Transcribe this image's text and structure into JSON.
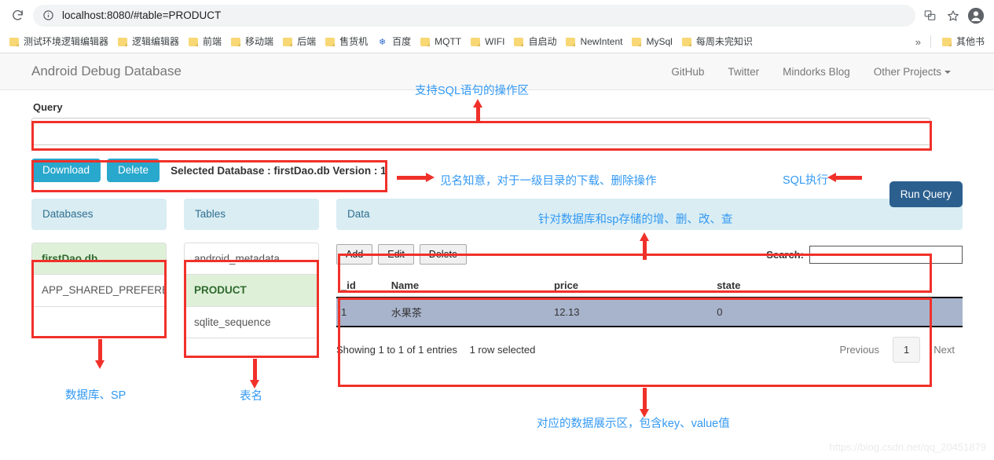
{
  "browser": {
    "url": "localhost:8080/#table=PRODUCT",
    "reload_icon": "reload-icon",
    "info_icon": "info-circle-icon",
    "translate_icon": "translate-icon",
    "bookmark_star_icon": "star-icon",
    "profile_icon": "account-avatar-icon",
    "overflow_icon": "chevron-double-right-icon",
    "bookmarks": [
      {
        "label": "测试环境逻辑编辑器",
        "icon": "folder-icon"
      },
      {
        "label": "逻辑编辑器",
        "icon": "folder-icon"
      },
      {
        "label": "前端",
        "icon": "folder-icon"
      },
      {
        "label": "移动端",
        "icon": "folder-icon"
      },
      {
        "label": "后端",
        "icon": "folder-icon"
      },
      {
        "label": "售货机",
        "icon": "folder-icon"
      },
      {
        "label": "百度",
        "icon": "baidu-paw-icon"
      },
      {
        "label": "MQTT",
        "icon": "folder-icon"
      },
      {
        "label": "WIFI",
        "icon": "folder-icon"
      },
      {
        "label": "自启动",
        "icon": "folder-icon"
      },
      {
        "label": "NewIntent",
        "icon": "folder-icon"
      },
      {
        "label": "MySql",
        "icon": "folder-icon"
      },
      {
        "label": "每周未完知识",
        "icon": "folder-icon"
      }
    ],
    "other_bookmarks": "其他书"
  },
  "navbar": {
    "brand": "Android Debug Database",
    "links": [
      {
        "label": "GitHub"
      },
      {
        "label": "Twitter"
      },
      {
        "label": "Mindorks Blog"
      },
      {
        "label": "Other Projects"
      }
    ]
  },
  "query": {
    "label": "Query",
    "value": "",
    "placeholder": "",
    "run_button": "Run Query"
  },
  "db_actions": {
    "download": "Download",
    "delete": "Delete",
    "selected_database": "Selected Database : firstDao.db Version : 1"
  },
  "databases_panel": {
    "header": "Databases",
    "items": [
      {
        "label": "firstDao.db",
        "selected": true
      },
      {
        "label": "APP_SHARED_PREFERENCES",
        "selected": false
      }
    ]
  },
  "tables_panel": {
    "header": "Tables",
    "items": [
      {
        "label": "android_metadata",
        "selected": false
      },
      {
        "label": "PRODUCT",
        "selected": true
      },
      {
        "label": "sqlite_sequence",
        "selected": false
      }
    ]
  },
  "data_panel": {
    "header": "Data",
    "toolbar": {
      "add": "Add",
      "edit": "Edit",
      "delete": "Delete",
      "search_label": "Search:",
      "search_value": "",
      "search_placeholder": ""
    },
    "table": {
      "columns": [
        "_id",
        "Name",
        "price",
        "state"
      ],
      "rows": [
        {
          "cells": [
            "1",
            "水果茶",
            "12.13",
            "0"
          ],
          "selected": true
        }
      ]
    },
    "footer": {
      "info": "Showing 1 to 1 of 1 entries",
      "selection": "1 row selected",
      "previous": "Previous",
      "page": "1",
      "next": "Next"
    }
  },
  "annotations": [
    {
      "id": "ann-query-area",
      "text": "支持SQL语句的操作区"
    },
    {
      "id": "ann-db-ops",
      "text": "见名知意，对于一级目录的下载、删除操作"
    },
    {
      "id": "ann-sql-exec",
      "text": "SQL执行"
    },
    {
      "id": "ann-crud",
      "text": "针对数据库和sp存储的增、删、改、查"
    },
    {
      "id": "ann-db-sp",
      "text": "数据库、SP"
    },
    {
      "id": "ann-table-name",
      "text": "表名"
    },
    {
      "id": "ann-data-area",
      "text": "对应的数据展示区，包含key、value值"
    }
  ],
  "watermark": "https://blog.csdn.net/qq_20451879",
  "colors": {
    "annotation_box": "#f0312a",
    "annotation_text": "#3399f3",
    "primary_button": "#29a8cd",
    "run_query_button": "#2b5f8e",
    "panel_header": "#d9edf3",
    "selected_row": "#a8b4cc",
    "selected_list_item": "#dff0d8"
  }
}
